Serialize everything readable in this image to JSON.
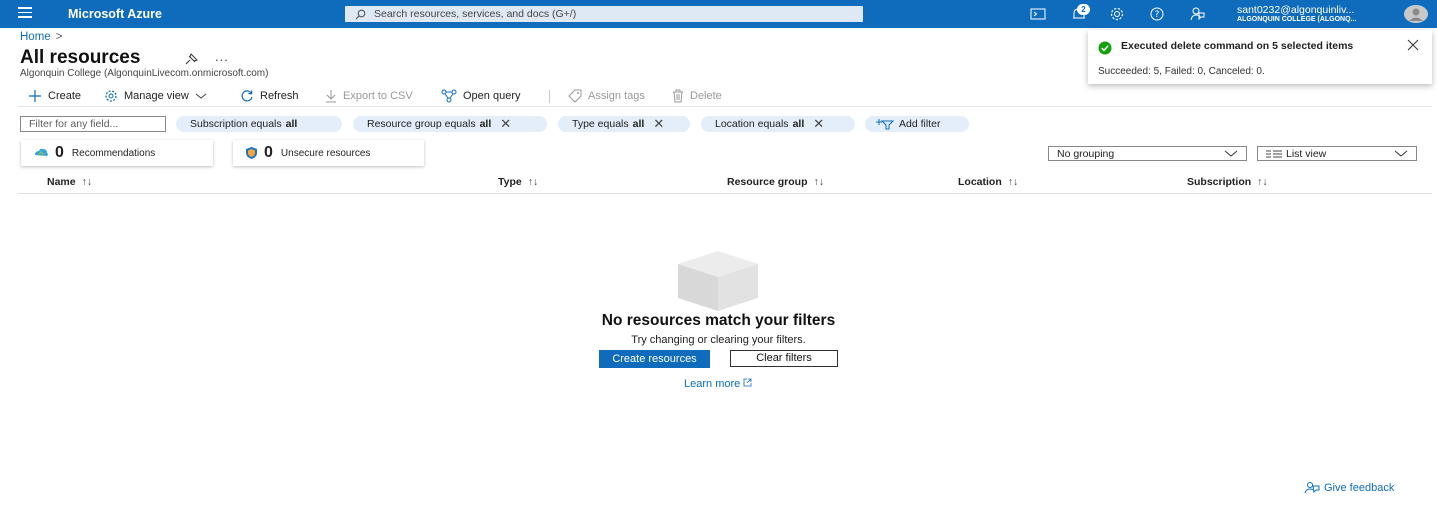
{
  "topbar": {
    "brand": "Microsoft Azure",
    "search_placeholder": "Search resources, services, and docs (G+/)",
    "notification_count": "2",
    "user_name": "sant0232@algonquinliv...",
    "user_org": "ALGONQUIN COLLEGE (ALGONQ...",
    "icons": [
      "cloud-shell-icon",
      "notifications-icon",
      "settings-icon",
      "help-icon",
      "feedback-icon"
    ]
  },
  "breadcrumb": {
    "home": "Home",
    "separator": ">"
  },
  "page": {
    "title": "All resources",
    "subtitle": "Algonquin College (AlgonquinLivecom.onmicrosoft.com)",
    "more": "..."
  },
  "toolbar": {
    "create": "Create",
    "manage_view": "Manage view",
    "refresh": "Refresh",
    "export_csv": "Export to CSV",
    "open_query": "Open query",
    "assign_tags": "Assign tags",
    "delete": "Delete"
  },
  "filters": {
    "placeholder": "Filter for any field...",
    "chips": [
      {
        "label": "Subscription equals",
        "value": "all"
      },
      {
        "label": "Resource group equals",
        "value": "all"
      },
      {
        "label": "Type equals",
        "value": "all"
      },
      {
        "label": "Location equals",
        "value": "all"
      }
    ],
    "add_filter": "Add filter",
    "close_glyph": "✕"
  },
  "cards": {
    "recommendations_count": "0",
    "recommendations_label": "Recommendations",
    "unsecure_count": "0",
    "unsecure_label": "Unsecure resources"
  },
  "view": {
    "grouping": "No grouping",
    "mode": "List view"
  },
  "table": {
    "sort_glyph": "↑↓",
    "columns": [
      "Name",
      "Type",
      "Resource group",
      "Location",
      "Subscription"
    ]
  },
  "empty": {
    "title": "No resources match your filters",
    "desc": "Try changing or clearing your filters.",
    "create_button": "Create resources",
    "clear_button": "Clear filters",
    "learn_more": "Learn more"
  },
  "toast": {
    "title": "Executed delete command on 5 selected items",
    "detail": "Succeeded: 5, Failed: 0, Canceled: 0."
  },
  "feedback": "Give feedback",
  "colors": {
    "azure_blue": "#0f6cbd",
    "chip_bg": "#e3eefa",
    "success": "#13a10e"
  }
}
